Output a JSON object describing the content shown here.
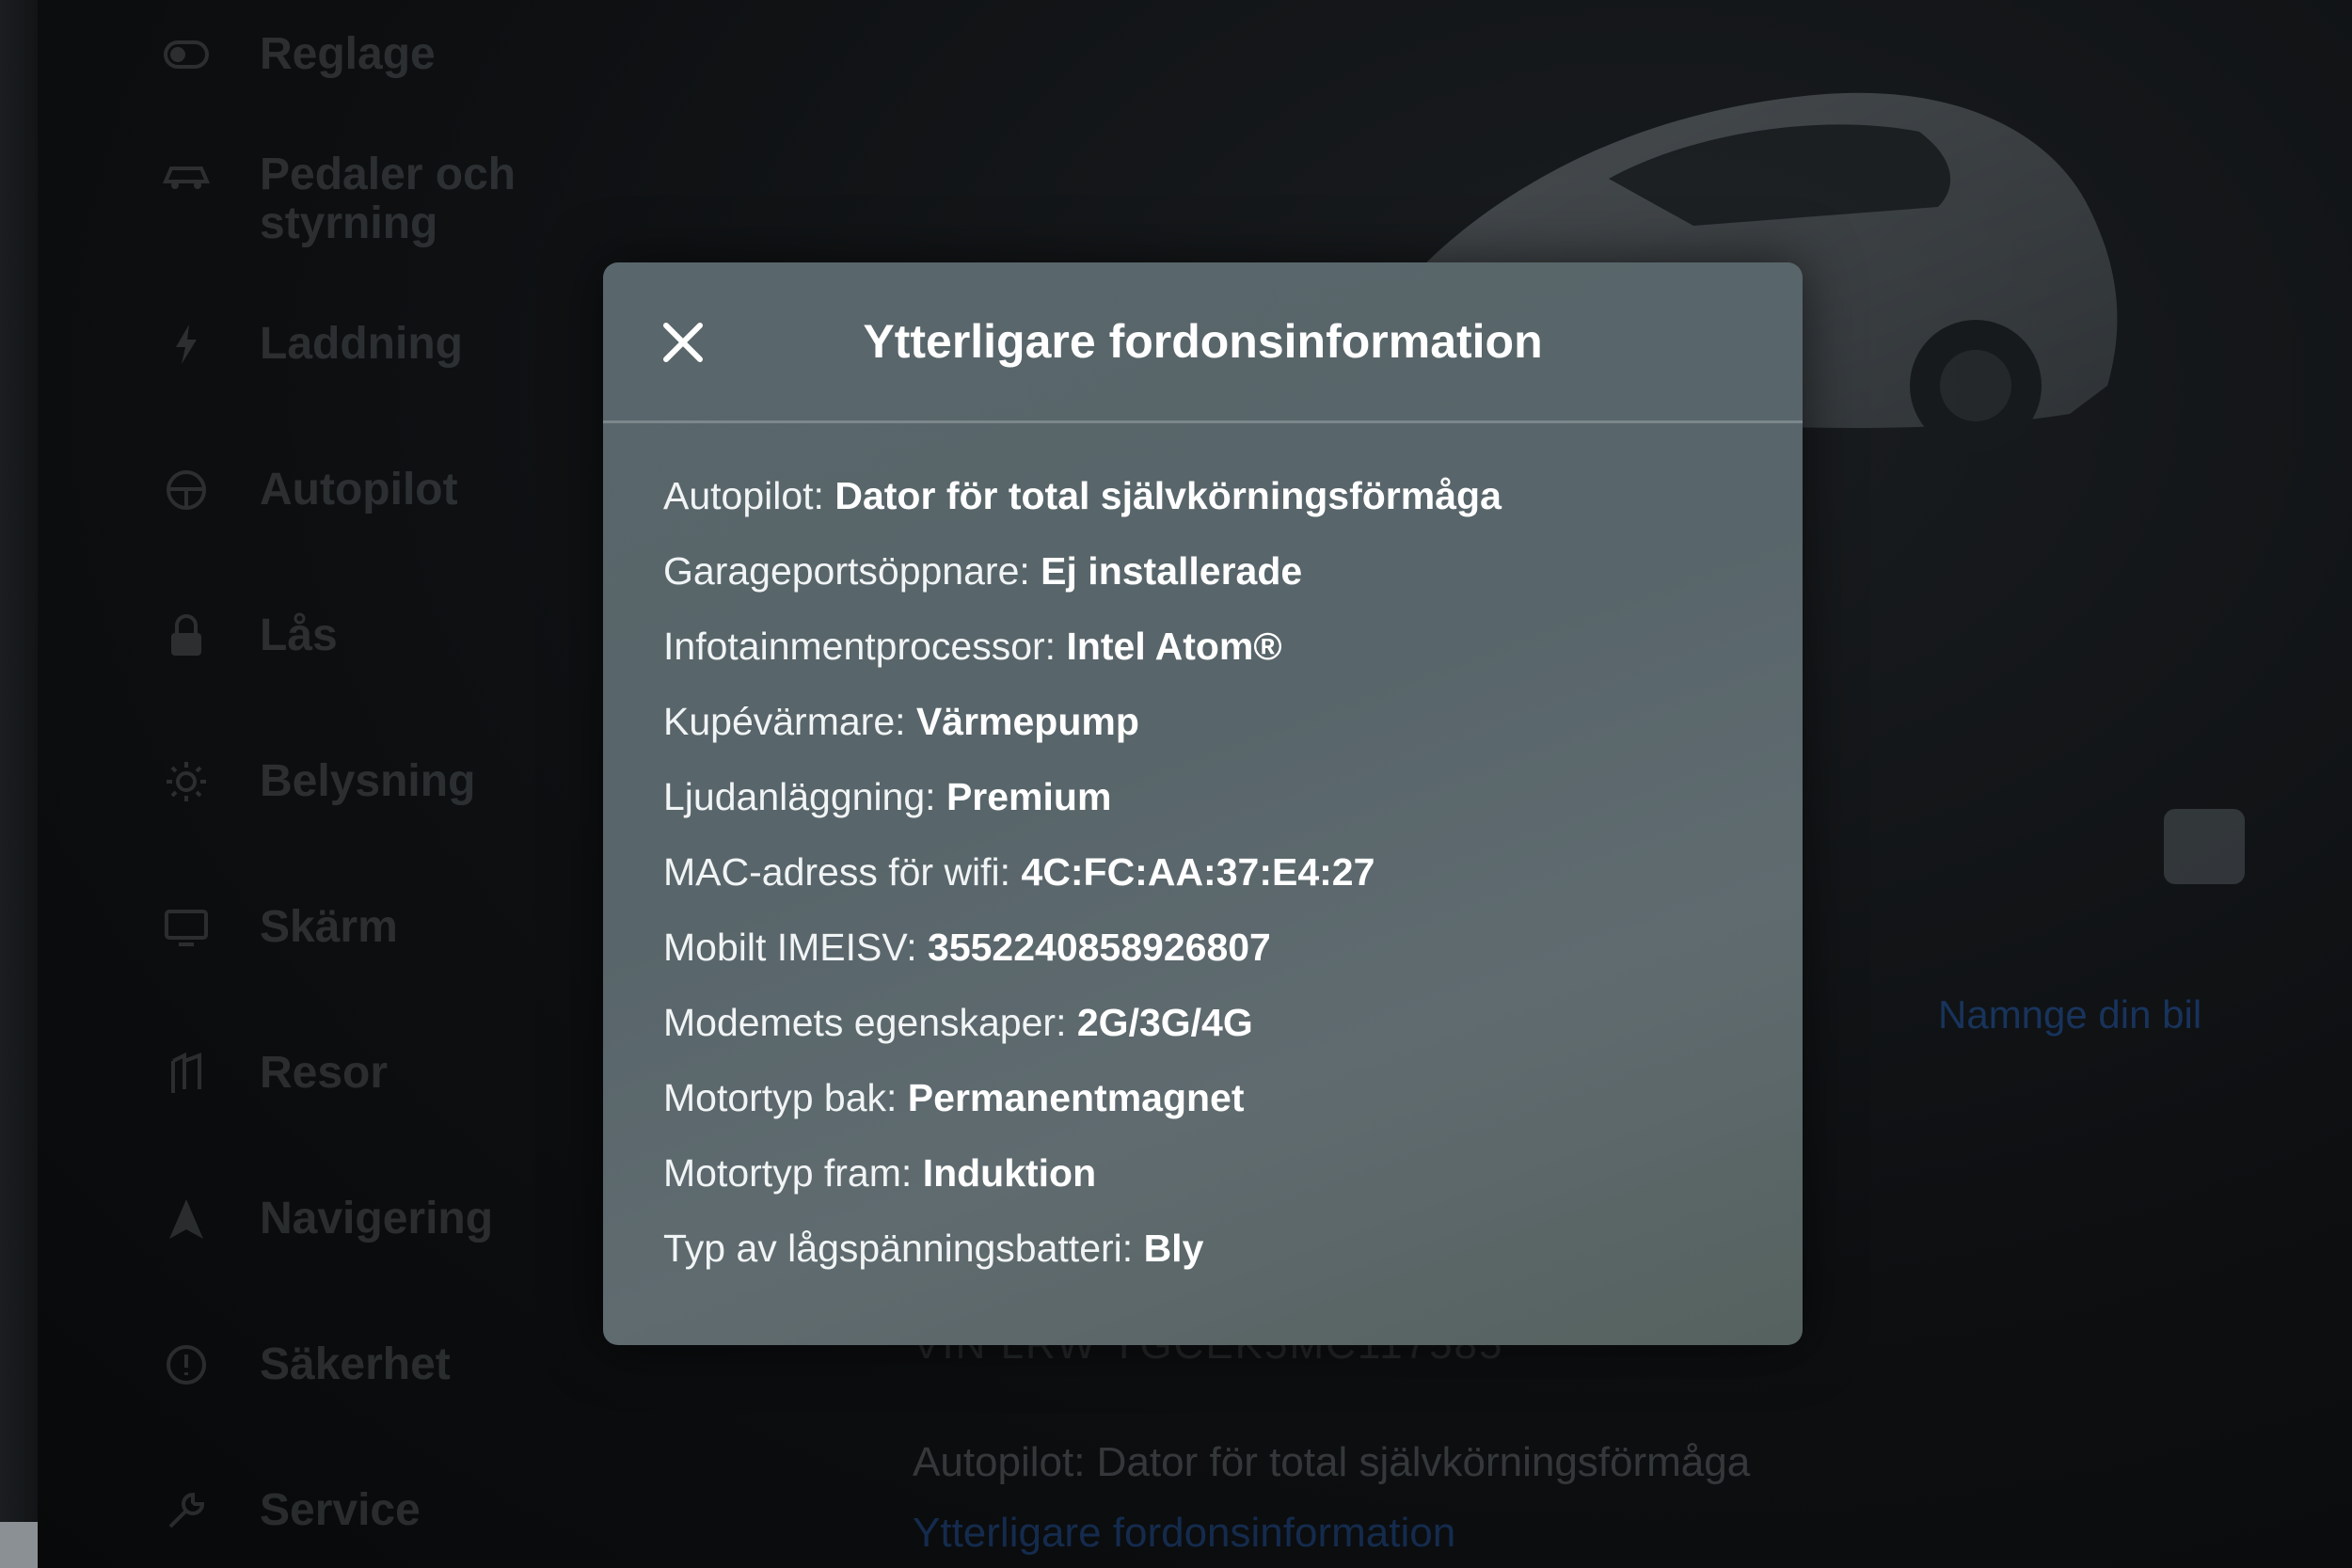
{
  "sidebar": {
    "items": [
      {
        "label": "Reglage",
        "icon": "toggle-icon"
      },
      {
        "label": "Pedaler och styrning",
        "icon": "car-icon"
      },
      {
        "label": "Laddning",
        "icon": "bolt-icon"
      },
      {
        "label": "Autopilot",
        "icon": "steering-wheel-icon"
      },
      {
        "label": "Lås",
        "icon": "lock-icon"
      },
      {
        "label": "Belysning",
        "icon": "sun-icon"
      },
      {
        "label": "Skärm",
        "icon": "display-icon"
      },
      {
        "label": "Resor",
        "icon": "trips-icon"
      },
      {
        "label": "Navigering",
        "icon": "navigation-arrow-icon"
      },
      {
        "label": "Säkerhet",
        "icon": "safety-icon"
      },
      {
        "label": "Service",
        "icon": "wrench-icon"
      }
    ]
  },
  "background": {
    "name_link": "Namnge din bil",
    "vin": "VIN LRW YGCEK5MC117585",
    "autopilot": "Autopilot: Dator för total självkörningsförmåga",
    "more_info_link": "Ytterligare fordonsinformation"
  },
  "modal": {
    "title": "Ytterligare fordonsinformation",
    "close_icon": "close-icon",
    "rows": [
      {
        "label": "Autopilot:",
        "value": "Dator för total självkörningsförmåga"
      },
      {
        "label": "Garageportsöppnare:",
        "value": "Ej installerade"
      },
      {
        "label": "Infotainmentprocessor:",
        "value": "Intel Atom®"
      },
      {
        "label": "Kupévärmare:",
        "value": "Värmepump"
      },
      {
        "label": "Ljudanläggning:",
        "value": "Premium"
      },
      {
        "label": "MAC-adress för wifi:",
        "value": "4C:FC:AA:37:E4:27"
      },
      {
        "label": "Mobilt IMEISV:",
        "value": "3552240858926807"
      },
      {
        "label": "Modemets egenskaper:",
        "value": "2G/3G/4G"
      },
      {
        "label": "Motortyp bak:",
        "value": "Permanentmagnet"
      },
      {
        "label": "Motortyp fram:",
        "value": "Induktion"
      },
      {
        "label": "Typ av lågspänningsbatteri:",
        "value": "Bly"
      }
    ]
  },
  "colors": {
    "modal_background": "#59666b",
    "link_blue": "#1e4a8c",
    "screen_background": "#0b0d0f"
  }
}
